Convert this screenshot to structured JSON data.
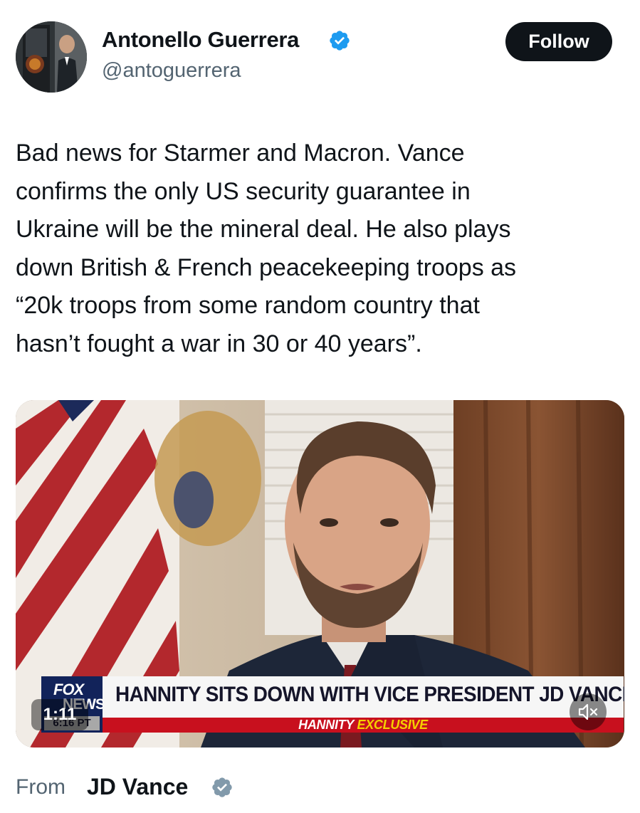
{
  "author": {
    "name": "Antonello Guerrera",
    "handle": "@antoguerrera",
    "verified_icon": "verified-badge-icon",
    "follow_label": "Follow"
  },
  "tweet": {
    "lines": [
      "Bad news for Starmer and Macron. Vance",
      "confirms the only US security guarantee in",
      "Ukraine will be the mineral deal. He also plays",
      "down British & French peacekeeping troops as",
      "“20k troops from some random country that",
      "hasn’t fought a war in 30 or 40 years”."
    ]
  },
  "video": {
    "chyron_headline": "HANNITY SITS DOWN WITH VICE PRESIDENT JD VANCE",
    "chyron_sub_white": "HANNITY",
    "chyron_sub_yellow": "EXCLUSIVE",
    "network_logo_top": "FOX",
    "network_logo_bottom": "NEWS",
    "network_clock": "6:16 PT",
    "duration": "1:11",
    "mute_icon": "speaker-muted-icon"
  },
  "source": {
    "from_label": "From",
    "name": "JD Vance",
    "badge_icon": "grey-verified-badge-icon"
  },
  "colors": {
    "accent_blue": "#1d9bf0",
    "text_primary": "#0f1419",
    "text_secondary": "#536471",
    "fox_red": "#c8101e",
    "fox_navy": "#12235a"
  }
}
